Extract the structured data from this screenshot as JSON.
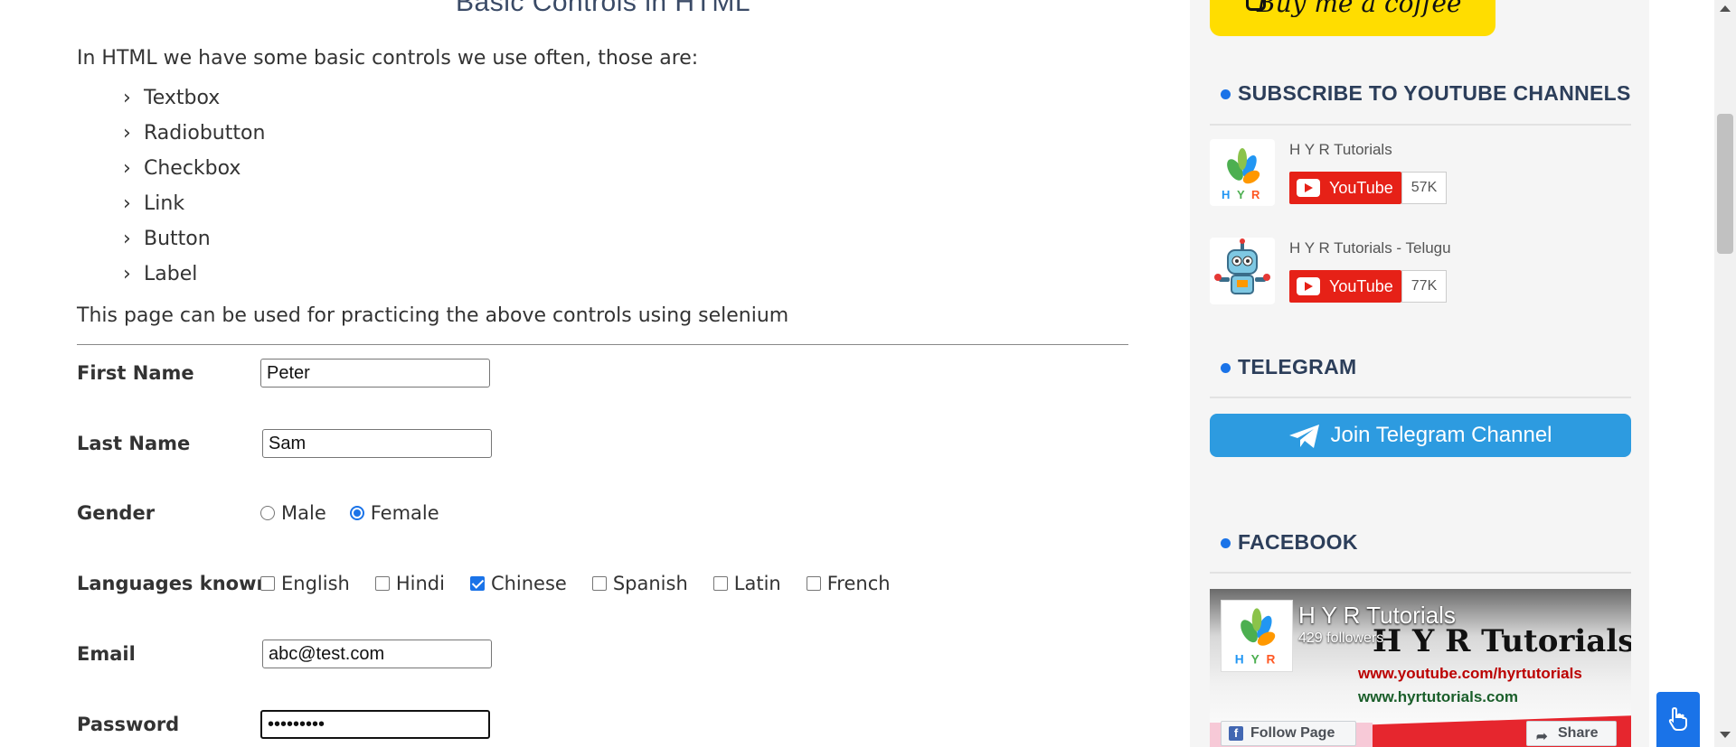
{
  "main": {
    "page_title": "Basic Controls in HTML",
    "intro": "In HTML we have some basic controls we use often, those are:",
    "controls": [
      "Textbox",
      "Radiobutton",
      "Checkbox",
      "Link",
      "Button",
      "Label"
    ],
    "note": "This page can be used for practicing the above controls using selenium"
  },
  "form": {
    "first_name": {
      "label": "First Name",
      "value": "Peter"
    },
    "last_name": {
      "label": "Last Name",
      "value": "Sam"
    },
    "gender": {
      "label": "Gender",
      "options": [
        "Male",
        "Female"
      ],
      "selected": "Female"
    },
    "languages": {
      "label": "Languages known",
      "options": [
        "English",
        "Hindi",
        "Chinese",
        "Spanish",
        "Latin",
        "French"
      ],
      "checked": [
        "Chinese"
      ]
    },
    "email": {
      "label": "Email",
      "value": "abc@test.com"
    },
    "password": {
      "label": "Password",
      "value": "•••••••••"
    }
  },
  "sidebar": {
    "coffee_label": "Buy me a coffee",
    "youtube": {
      "heading": "SUBSCRIBE TO YOUTUBE CHANNELS",
      "channels": [
        {
          "name": "H Y R Tutorials",
          "button": "YouTube",
          "count": "57K"
        },
        {
          "name": "H Y R Tutorials - Telugu",
          "button": "YouTube",
          "count": "77K"
        }
      ]
    },
    "telegram": {
      "heading": "TELEGRAM",
      "button": "Join Telegram Channel"
    },
    "facebook": {
      "heading": "FACEBOOK",
      "page_name": "H Y R Tutorials",
      "followers": "429 followers",
      "cover_text": "H Y R Tutorials",
      "cover_url1": "www.youtube.com/hyrtutorials",
      "cover_url2": "www.hyrtutorials.com",
      "follow_button": "Follow Page",
      "share_button": "Share"
    }
  },
  "colors": {
    "accent": "#1a73e8",
    "youtube_red": "#e62117",
    "telegram_blue": "#2d9be0",
    "coffee_yellow": "#ffdd00",
    "heading_navy": "#2c3e5a"
  }
}
